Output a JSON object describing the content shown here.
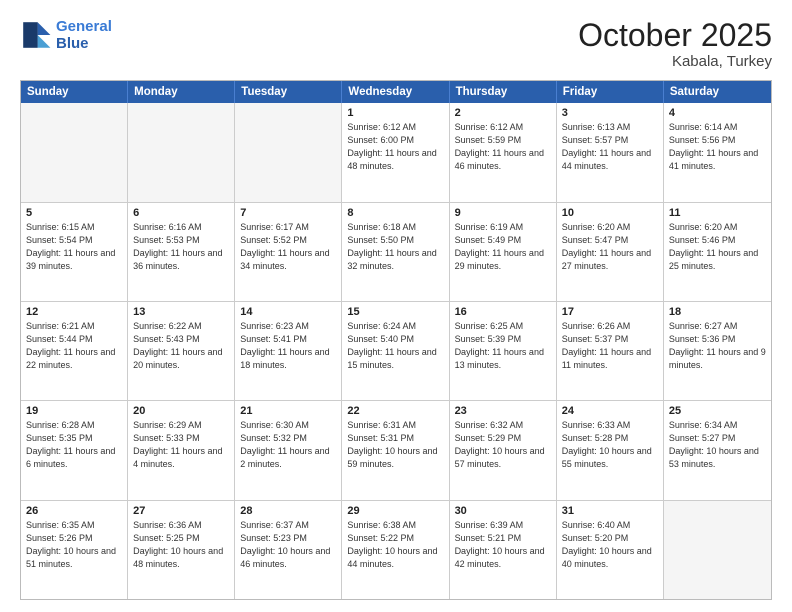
{
  "header": {
    "logo_line1": "General",
    "logo_line2": "Blue",
    "month_title": "October 2025",
    "location": "Kabala, Turkey"
  },
  "days_of_week": [
    "Sunday",
    "Monday",
    "Tuesday",
    "Wednesday",
    "Thursday",
    "Friday",
    "Saturday"
  ],
  "weeks": [
    [
      {
        "day": "",
        "text": ""
      },
      {
        "day": "",
        "text": ""
      },
      {
        "day": "",
        "text": ""
      },
      {
        "day": "1",
        "text": "Sunrise: 6:12 AM\nSunset: 6:00 PM\nDaylight: 11 hours and 48 minutes."
      },
      {
        "day": "2",
        "text": "Sunrise: 6:12 AM\nSunset: 5:59 PM\nDaylight: 11 hours and 46 minutes."
      },
      {
        "day": "3",
        "text": "Sunrise: 6:13 AM\nSunset: 5:57 PM\nDaylight: 11 hours and 44 minutes."
      },
      {
        "day": "4",
        "text": "Sunrise: 6:14 AM\nSunset: 5:56 PM\nDaylight: 11 hours and 41 minutes."
      }
    ],
    [
      {
        "day": "5",
        "text": "Sunrise: 6:15 AM\nSunset: 5:54 PM\nDaylight: 11 hours and 39 minutes."
      },
      {
        "day": "6",
        "text": "Sunrise: 6:16 AM\nSunset: 5:53 PM\nDaylight: 11 hours and 36 minutes."
      },
      {
        "day": "7",
        "text": "Sunrise: 6:17 AM\nSunset: 5:52 PM\nDaylight: 11 hours and 34 minutes."
      },
      {
        "day": "8",
        "text": "Sunrise: 6:18 AM\nSunset: 5:50 PM\nDaylight: 11 hours and 32 minutes."
      },
      {
        "day": "9",
        "text": "Sunrise: 6:19 AM\nSunset: 5:49 PM\nDaylight: 11 hours and 29 minutes."
      },
      {
        "day": "10",
        "text": "Sunrise: 6:20 AM\nSunset: 5:47 PM\nDaylight: 11 hours and 27 minutes."
      },
      {
        "day": "11",
        "text": "Sunrise: 6:20 AM\nSunset: 5:46 PM\nDaylight: 11 hours and 25 minutes."
      }
    ],
    [
      {
        "day": "12",
        "text": "Sunrise: 6:21 AM\nSunset: 5:44 PM\nDaylight: 11 hours and 22 minutes."
      },
      {
        "day": "13",
        "text": "Sunrise: 6:22 AM\nSunset: 5:43 PM\nDaylight: 11 hours and 20 minutes."
      },
      {
        "day": "14",
        "text": "Sunrise: 6:23 AM\nSunset: 5:41 PM\nDaylight: 11 hours and 18 minutes."
      },
      {
        "day": "15",
        "text": "Sunrise: 6:24 AM\nSunset: 5:40 PM\nDaylight: 11 hours and 15 minutes."
      },
      {
        "day": "16",
        "text": "Sunrise: 6:25 AM\nSunset: 5:39 PM\nDaylight: 11 hours and 13 minutes."
      },
      {
        "day": "17",
        "text": "Sunrise: 6:26 AM\nSunset: 5:37 PM\nDaylight: 11 hours and 11 minutes."
      },
      {
        "day": "18",
        "text": "Sunrise: 6:27 AM\nSunset: 5:36 PM\nDaylight: 11 hours and 9 minutes."
      }
    ],
    [
      {
        "day": "19",
        "text": "Sunrise: 6:28 AM\nSunset: 5:35 PM\nDaylight: 11 hours and 6 minutes."
      },
      {
        "day": "20",
        "text": "Sunrise: 6:29 AM\nSunset: 5:33 PM\nDaylight: 11 hours and 4 minutes."
      },
      {
        "day": "21",
        "text": "Sunrise: 6:30 AM\nSunset: 5:32 PM\nDaylight: 11 hours and 2 minutes."
      },
      {
        "day": "22",
        "text": "Sunrise: 6:31 AM\nSunset: 5:31 PM\nDaylight: 10 hours and 59 minutes."
      },
      {
        "day": "23",
        "text": "Sunrise: 6:32 AM\nSunset: 5:29 PM\nDaylight: 10 hours and 57 minutes."
      },
      {
        "day": "24",
        "text": "Sunrise: 6:33 AM\nSunset: 5:28 PM\nDaylight: 10 hours and 55 minutes."
      },
      {
        "day": "25",
        "text": "Sunrise: 6:34 AM\nSunset: 5:27 PM\nDaylight: 10 hours and 53 minutes."
      }
    ],
    [
      {
        "day": "26",
        "text": "Sunrise: 6:35 AM\nSunset: 5:26 PM\nDaylight: 10 hours and 51 minutes."
      },
      {
        "day": "27",
        "text": "Sunrise: 6:36 AM\nSunset: 5:25 PM\nDaylight: 10 hours and 48 minutes."
      },
      {
        "day": "28",
        "text": "Sunrise: 6:37 AM\nSunset: 5:23 PM\nDaylight: 10 hours and 46 minutes."
      },
      {
        "day": "29",
        "text": "Sunrise: 6:38 AM\nSunset: 5:22 PM\nDaylight: 10 hours and 44 minutes."
      },
      {
        "day": "30",
        "text": "Sunrise: 6:39 AM\nSunset: 5:21 PM\nDaylight: 10 hours and 42 minutes."
      },
      {
        "day": "31",
        "text": "Sunrise: 6:40 AM\nSunset: 5:20 PM\nDaylight: 10 hours and 40 minutes."
      },
      {
        "day": "",
        "text": ""
      }
    ]
  ]
}
